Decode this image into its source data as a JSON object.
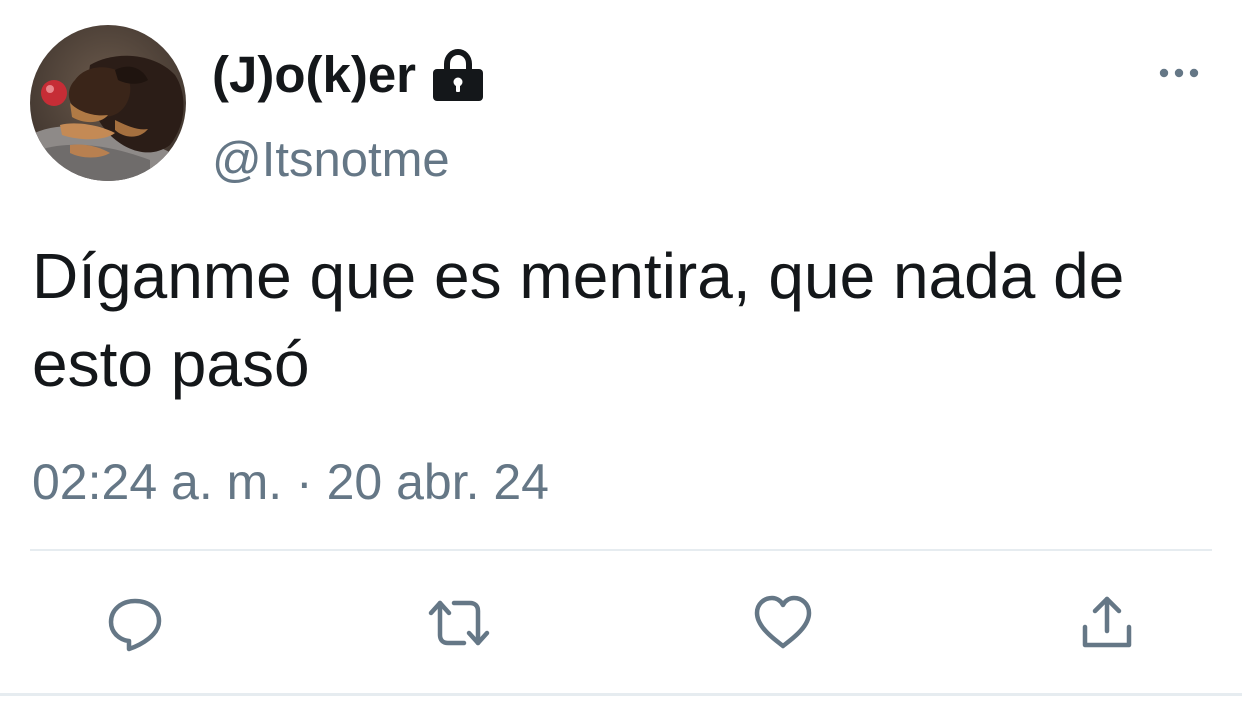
{
  "user": {
    "display_name": "(J)o(k)er",
    "handle": "@Itsnotme",
    "protected_icon": "lock-icon",
    "avatar_icon": "avatar"
  },
  "tweet": {
    "text": "Díganme que es mentira, que nada de esto pasó",
    "timestamp": "02:24 a. m. · 20 abr. 24"
  },
  "actions": {
    "more_icon": "more-icon",
    "reply_icon": "reply-icon",
    "retweet_icon": "retweet-icon",
    "like_icon": "heart-icon",
    "share_icon": "share-icon"
  },
  "colors": {
    "text": "#14171a",
    "secondary": "#657786",
    "divider": "#e6ecf0",
    "background": "#ffffff"
  }
}
